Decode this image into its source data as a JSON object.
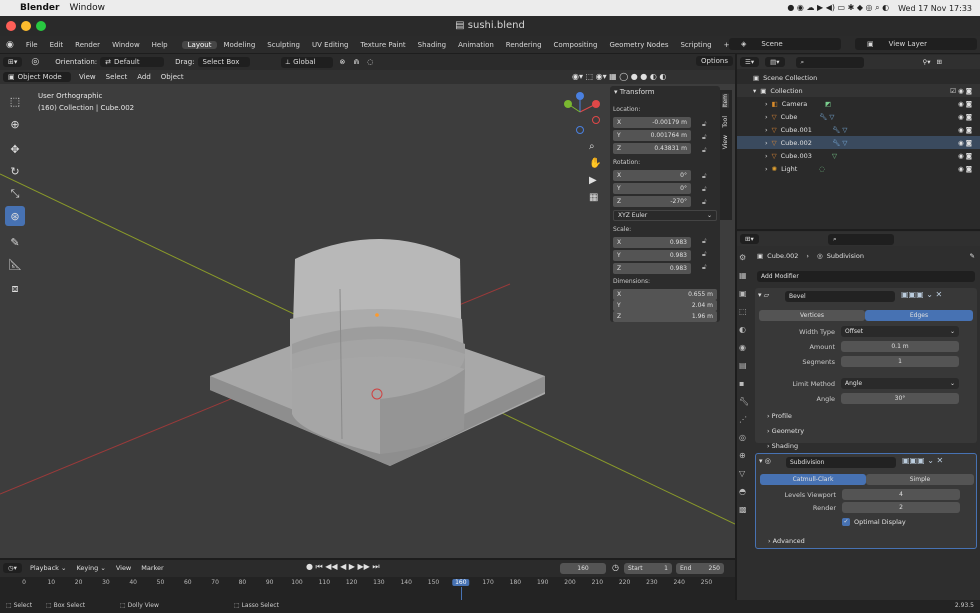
{
  "mac": {
    "apple": "",
    "app": "Blender",
    "menu": "Window",
    "datetime": "Wed 17 Nov 17:33"
  },
  "window": {
    "title": "sushi.blend"
  },
  "menus": [
    "File",
    "Edit",
    "Render",
    "Window",
    "Help"
  ],
  "workspaces": [
    "Layout",
    "Modeling",
    "Sculpting",
    "UV Editing",
    "Texture Paint",
    "Shading",
    "Animation",
    "Rendering",
    "Compositing",
    "Geometry Nodes",
    "Scripting"
  ],
  "active_workspace": "Layout",
  "scene": "Scene",
  "view_layer": "View Layer",
  "vp": {
    "orientation_label": "Orientation:",
    "orientation": "Default",
    "drag_label": "Drag:",
    "drag": "Select Box",
    "transform_orient": "Global",
    "options": "Options",
    "mode": "Object Mode",
    "view": "View",
    "select": "Select",
    "add": "Add",
    "object": "Object",
    "info1": "User Orthographic",
    "info2": "(160) Collection | Cube.002"
  },
  "npanel": {
    "title": "Transform",
    "location": "Location:",
    "loc": [
      "-0.00179 m",
      "0.001764 m",
      "0.43831 m"
    ],
    "rotation": "Rotation:",
    "rot": [
      "0°",
      "0°",
      "-270°"
    ],
    "rotmode": "XYZ Euler",
    "scale": "Scale:",
    "scl": [
      "0.983",
      "0.983",
      "0.983"
    ],
    "dimensions": "Dimensions:",
    "dim": [
      "0.655 m",
      "2.04 m",
      "1.96 m"
    ],
    "axes": [
      "X",
      "Y",
      "Z"
    ],
    "tabs": [
      "Item",
      "Tool",
      "View"
    ]
  },
  "outliner": {
    "root": "Scene Collection",
    "items": [
      {
        "name": "Collection"
      },
      {
        "name": "Camera"
      },
      {
        "name": "Cube"
      },
      {
        "name": "Cube.001"
      },
      {
        "name": "Cube.002"
      },
      {
        "name": "Cube.003"
      },
      {
        "name": "Light"
      }
    ]
  },
  "props": {
    "object": "Cube.002",
    "modifier": "Subdivision",
    "add_modifier": "Add Modifier",
    "bevel": {
      "name": "Bevel",
      "tabs": [
        "Vertices",
        "Edges"
      ],
      "width_type_label": "Width Type",
      "width_type": "Offset",
      "amount_label": "Amount",
      "amount": "0.1 m",
      "segments_label": "Segments",
      "segments": "1",
      "limit_label": "Limit Method",
      "limit": "Angle",
      "angle_label": "Angle",
      "angle": "30°",
      "sub": [
        "Profile",
        "Geometry",
        "Shading"
      ]
    },
    "subdiv": {
      "name": "Subdivision",
      "tabs": [
        "Catmull-Clark",
        "Simple"
      ],
      "levels_label": "Levels Viewport",
      "levels": "4",
      "render_label": "Render",
      "render": "2",
      "optimal": "Optimal Display",
      "advanced": "Advanced"
    }
  },
  "timeline": {
    "menus": [
      "Playback",
      "Keying",
      "View",
      "Marker"
    ],
    "current": "160",
    "start_label": "Start",
    "start": "1",
    "end_label": "End",
    "end": "250",
    "ticks": [
      "0",
      "10",
      "20",
      "30",
      "40",
      "50",
      "60",
      "70",
      "80",
      "90",
      "100",
      "110",
      "120",
      "130",
      "140",
      "150",
      "160",
      "170",
      "180",
      "190",
      "200",
      "210",
      "220",
      "230",
      "240",
      "250"
    ]
  },
  "status": {
    "select": "Select",
    "box_select": "Box Select",
    "dolly": "Dolly View",
    "lasso": "Lasso Select",
    "version": "2.93.5"
  }
}
